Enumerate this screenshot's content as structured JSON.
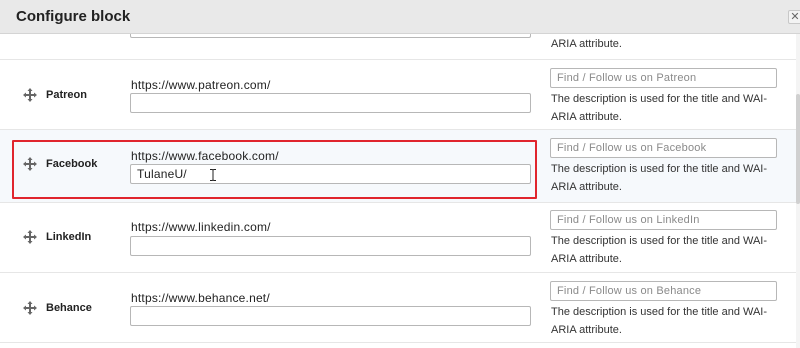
{
  "dialog": {
    "title": "Configure block",
    "close_glyph": "✕"
  },
  "top_partial": {
    "desc_tail": "ARIA attribute."
  },
  "rows": [
    {
      "name": "Patreon",
      "base_url": "https://www.patreon.com/",
      "value": "",
      "desc_placeholder": "Find / Follow us on Patreon",
      "desc_help": "The description is used for the title and WAI-ARIA attribute."
    },
    {
      "name": "Facebook",
      "base_url": "https://www.facebook.com/",
      "value": "TulaneU/",
      "desc_placeholder": "Find / Follow us on Facebook",
      "desc_help": "The description is used for the title and WAI-ARIA attribute."
    },
    {
      "name": "LinkedIn",
      "base_url": "https://www.linkedin.com/",
      "value": "",
      "desc_placeholder": "Find / Follow us on LinkedIn",
      "desc_help": "The description is used for the title and WAI-ARIA attribute."
    },
    {
      "name": "Behance",
      "base_url": "https://www.behance.net/",
      "value": "",
      "desc_placeholder": "Find / Follow us on Behance",
      "desc_help": "The description is used for the title and WAI-ARIA attribute."
    }
  ],
  "colors": {
    "highlight_border": "#e0252d",
    "titlebar_bg": "#e9e9e9"
  },
  "icons": {
    "drag": "drag-handle-icon",
    "close": "close-icon",
    "text_cursor": "text-cursor-icon"
  }
}
